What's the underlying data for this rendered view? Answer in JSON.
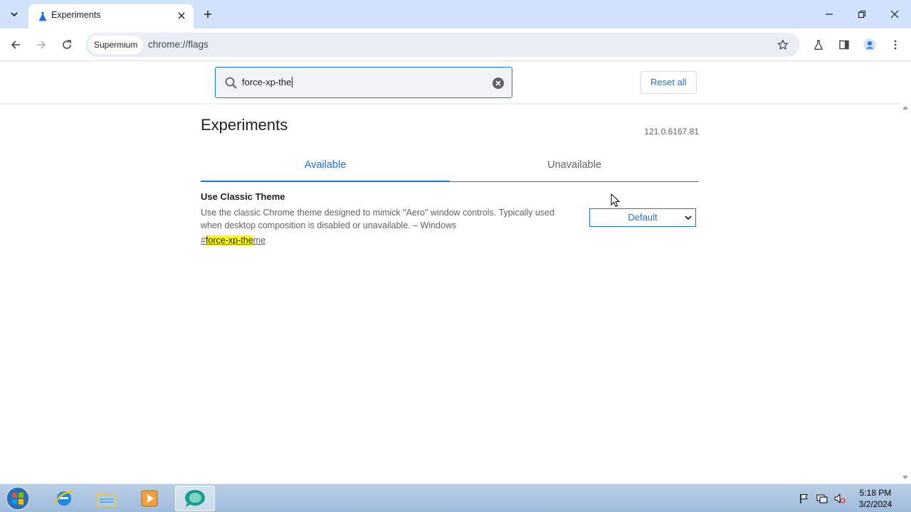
{
  "browser": {
    "tab": {
      "title": "Experiments",
      "icon": "flask-icon"
    },
    "toolbar": {
      "chip_label": "Supermium",
      "url": "chrome://flags"
    }
  },
  "flags_page": {
    "search": {
      "value": "force-xp-the",
      "icon": "search-icon"
    },
    "reset_all_label": "Reset all",
    "title": "Experiments",
    "version": "121.0.6167.81",
    "tabs": [
      {
        "label": "Available",
        "active": true
      },
      {
        "label": "Unavailable",
        "active": false
      }
    ],
    "flags": [
      {
        "name": "Use Classic Theme",
        "description": "Use the classic Chrome theme designed to mimick \"Aero\" window controls. Typically used when desktop composition is disabled or unavailable. – Windows",
        "link_prefix": "#",
        "link_highlight": "force-xp-the",
        "link_rest": "me",
        "selected_option": "Default"
      }
    ]
  },
  "taskbar": {
    "apps": [
      "internet-explorer-icon",
      "file-explorer-icon",
      "media-player-icon",
      "supermium-icon"
    ],
    "clock": {
      "time": "5:18 PM",
      "date": "3/2/2024"
    }
  },
  "colors": {
    "accent": "#1a73e8",
    "tabstrip": "#d3e3fd",
    "highlight": "#ffff00"
  }
}
